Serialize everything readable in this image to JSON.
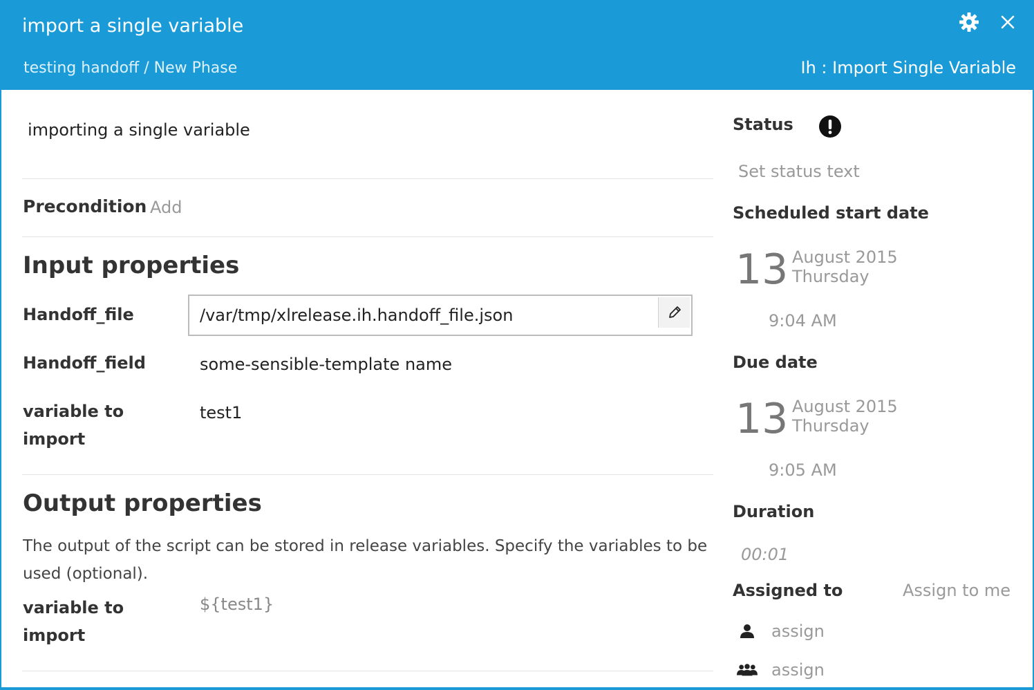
{
  "header": {
    "title": "import a single variable",
    "breadcrumb": "testing handoff / New Phase",
    "task_type": "Ih : Import Single Variable"
  },
  "main": {
    "description": "importing a single variable",
    "precondition_label": "Precondition",
    "precondition_add": "Add",
    "input_title": "Input properties",
    "inputs": [
      {
        "label": "Handoff_file",
        "value": "/var/tmp/xlrelease.ih.handoff_file.json"
      },
      {
        "label": "Handoff_field",
        "value": "some-sensible-template name"
      },
      {
        "label_line1": "variable to",
        "label_line2": "import",
        "value": "test1"
      }
    ],
    "output_title": "Output properties",
    "output_description": "The output of the script can be stored in release variables. Specify the variables to be used (optional).",
    "outputs": [
      {
        "label_line1": "variable to",
        "label_line2": "import",
        "value": "${test1}"
      }
    ]
  },
  "sidebar": {
    "status_label": "Status",
    "status_placeholder": "Set status text",
    "start_label": "Scheduled start date",
    "start": {
      "day": "13",
      "month_year": "August 2015",
      "weekday": "Thursday",
      "time": "9:04 AM"
    },
    "due_label": "Due date",
    "due": {
      "day": "13",
      "month_year": "August 2015",
      "weekday": "Thursday",
      "time": "9:05 AM"
    },
    "duration_label": "Duration",
    "duration_value": "00:01",
    "assigned_label": "Assigned to",
    "assign_me": "Assign to me",
    "assign_user": "assign",
    "assign_team": "assign"
  },
  "colors": {
    "header_bg": "#1a9bd7",
    "muted_text": "#999999"
  },
  "icons": [
    "gear-icon",
    "close-icon",
    "pencil-icon",
    "exclamation-icon",
    "user-icon",
    "team-icon"
  ]
}
